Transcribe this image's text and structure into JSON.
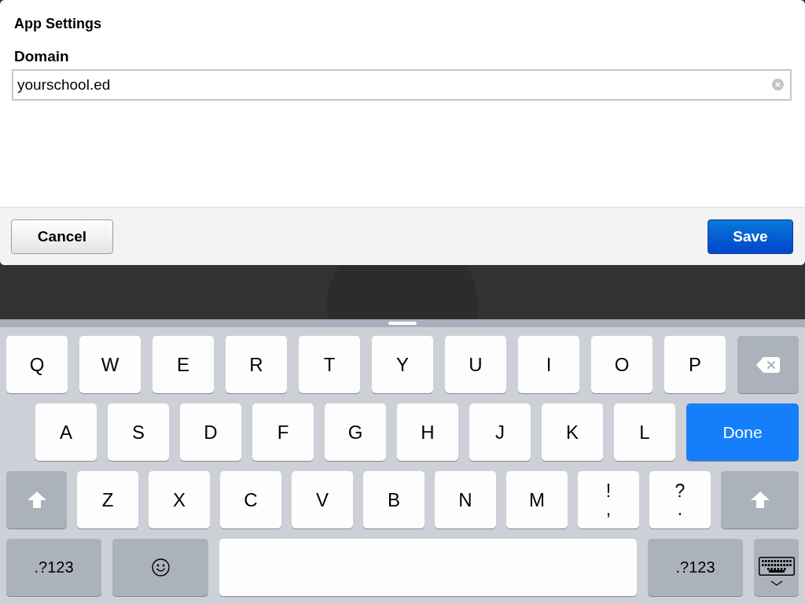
{
  "dialog": {
    "title": "App Settings",
    "field": {
      "label": "Domain",
      "value": "yourschool.ed",
      "clear_button": true
    }
  },
  "footer": {
    "buttons": [
      {
        "label": "Cancel",
        "kind": "secondary"
      },
      {
        "label": "Save",
        "kind": "primary"
      }
    ]
  },
  "keyboard": {
    "rows": [
      {
        "keys": [
          {
            "kind": "letter",
            "label": "Q"
          },
          {
            "kind": "letter",
            "label": "W"
          },
          {
            "kind": "letter",
            "label": "E"
          },
          {
            "kind": "letter",
            "label": "R"
          },
          {
            "kind": "letter",
            "label": "T"
          },
          {
            "kind": "letter",
            "label": "Y"
          },
          {
            "kind": "letter",
            "label": "U"
          },
          {
            "kind": "letter",
            "label": "I"
          },
          {
            "kind": "letter",
            "label": "O"
          },
          {
            "kind": "letter",
            "label": "P"
          },
          {
            "kind": "backspace"
          }
        ]
      },
      {
        "keys": [
          {
            "kind": "letter",
            "label": "A"
          },
          {
            "kind": "letter",
            "label": "S"
          },
          {
            "kind": "letter",
            "label": "D"
          },
          {
            "kind": "letter",
            "label": "F"
          },
          {
            "kind": "letter",
            "label": "G"
          },
          {
            "kind": "letter",
            "label": "H"
          },
          {
            "kind": "letter",
            "label": "J"
          },
          {
            "kind": "letter",
            "label": "K"
          },
          {
            "kind": "letter",
            "label": "L"
          },
          {
            "kind": "done",
            "label": "Done"
          }
        ]
      },
      {
        "keys": [
          {
            "kind": "shift"
          },
          {
            "kind": "letter",
            "label": "Z"
          },
          {
            "kind": "letter",
            "label": "X"
          },
          {
            "kind": "letter",
            "label": "C"
          },
          {
            "kind": "letter",
            "label": "V"
          },
          {
            "kind": "letter",
            "label": "B"
          },
          {
            "kind": "letter",
            "label": "N"
          },
          {
            "kind": "letter",
            "label": "M"
          },
          {
            "kind": "punctuation",
            "top": "!",
            "bottom": ","
          },
          {
            "kind": "punctuation",
            "top": "?",
            "bottom": "."
          },
          {
            "kind": "shift"
          }
        ]
      },
      {
        "keys": [
          {
            "kind": "mode",
            "label": ".?123"
          },
          {
            "kind": "emoji"
          },
          {
            "kind": "space"
          },
          {
            "kind": "mode",
            "label": ".?123"
          },
          {
            "kind": "dismiss"
          }
        ]
      }
    ]
  }
}
